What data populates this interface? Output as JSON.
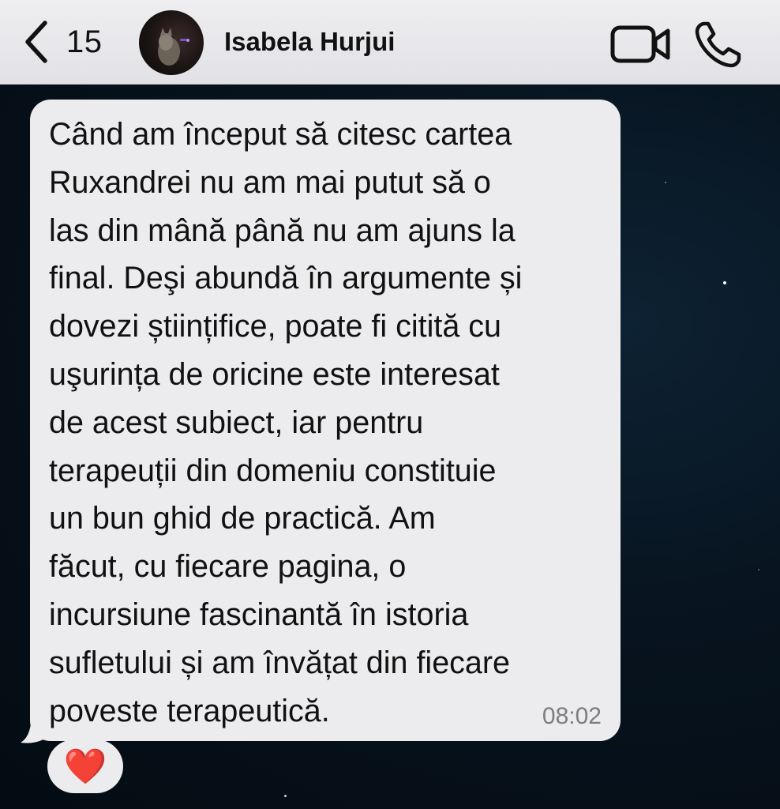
{
  "header": {
    "back_count": "15",
    "contact_name": "Isabela Hurjui",
    "icons": [
      "chevron-left-icon",
      "video-call-icon",
      "phone-icon"
    ]
  },
  "message": {
    "text": "Când am început să citesc cartea\nRuxandrei nu am mai putut să o\nlas din mână până nu am ajuns la\nfinal. Deşi abundă în argumente și\ndovezi științifice, poate fi citită cu\nuşurința de oricine este interesat\nde acest subiect, iar pentru\nterapeuții din domeniu constituie\nun bun ghid de practică. Am\nfăcut, cu fiecare pagina, o\nincursiune fascinantă în istoria\nsufletului și am învățat din fiecare\npoveste terapeutică.",
    "time": "08:02",
    "reaction": "❤️"
  },
  "colors": {
    "bubble": "#ececee",
    "header": "#e6e6ea",
    "reaction_heart": "#e0142b",
    "background": "#06111b"
  }
}
